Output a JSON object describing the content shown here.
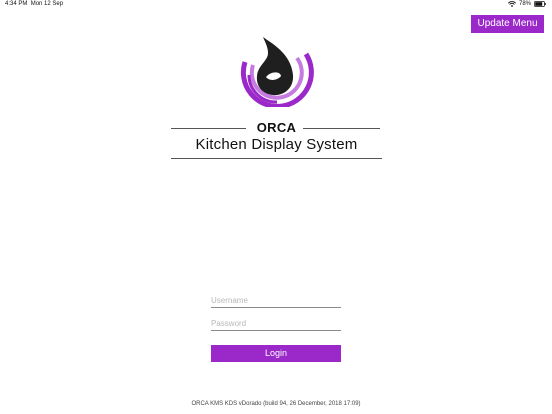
{
  "status_bar": {
    "time": "4:34 PM",
    "date": "Mon 12 Sep",
    "battery": "78%"
  },
  "header": {
    "update_menu_label": "Update Menu"
  },
  "brand": {
    "name": "ORCA",
    "subtitle": "Kitchen Display System"
  },
  "login": {
    "username_placeholder": "Username",
    "username_value": "",
    "password_placeholder": "Password",
    "password_value": "",
    "login_label": "Login"
  },
  "footer": {
    "build_info": "ORCA KMS KDS vDorado (build 94, 26 December, 2018 17:09)"
  },
  "colors": {
    "accent": "#9b28c9",
    "accent_light": "#c57be0",
    "logo_dark": "#1f1f1f"
  },
  "icons": {
    "status_wifi": "wifi-icon",
    "status_battery": "battery-icon",
    "logo": "orca-logo-icon"
  }
}
